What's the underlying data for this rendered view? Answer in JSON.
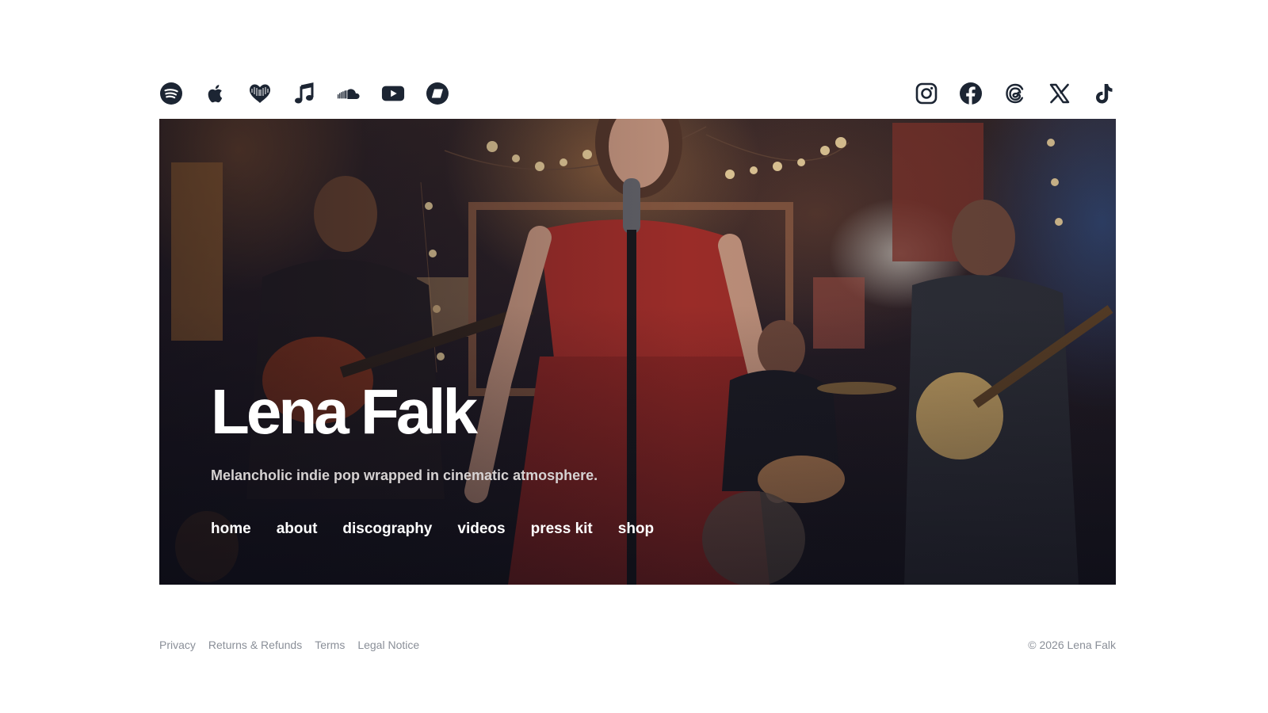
{
  "streaming_icons": [
    {
      "name": "spotify-icon"
    },
    {
      "name": "apple-music-icon"
    },
    {
      "name": "deezer-icon"
    },
    {
      "name": "music-note-icon"
    },
    {
      "name": "soundcloud-icon"
    },
    {
      "name": "youtube-icon"
    },
    {
      "name": "bandcamp-icon"
    }
  ],
  "social_icons": [
    {
      "name": "instagram-icon"
    },
    {
      "name": "facebook-icon"
    },
    {
      "name": "threads-icon"
    },
    {
      "name": "x-icon"
    },
    {
      "name": "tiktok-icon"
    }
  ],
  "colors": {
    "icon": "#1c2533",
    "footer_text": "#8a8f98",
    "hero_text": "#ffffff",
    "dress_red": "#b3322c"
  },
  "hero": {
    "title": "Lena Falk",
    "tagline": "Melancholic indie pop wrapped in cinematic atmosphere.",
    "nav": [
      "home",
      "about",
      "discography",
      "videos",
      "press kit",
      "shop"
    ]
  },
  "footer": {
    "links": [
      "Privacy",
      "Returns & Refunds",
      "Terms",
      "Legal Notice"
    ],
    "copyright": "© 2026 Lena Falk"
  }
}
